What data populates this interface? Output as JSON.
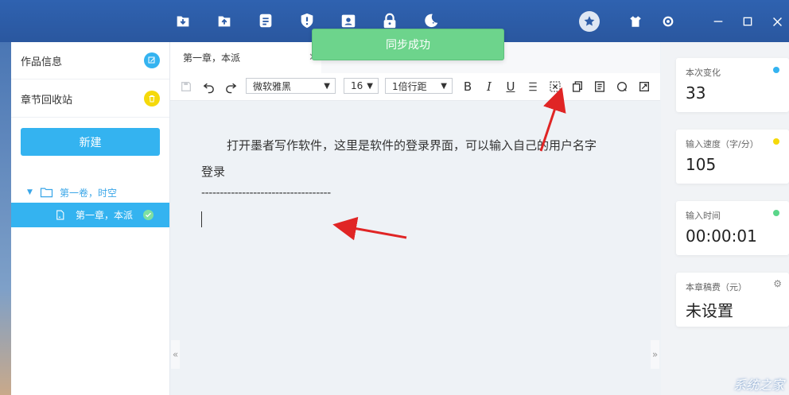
{
  "toolbar_icons": [
    "download-icon",
    "upload-icon",
    "notes-icon",
    "shield-icon",
    "contact-card-icon",
    "lock-icon",
    "night-mode-icon"
  ],
  "window_icons": [
    "favorites-icon",
    "skin-icon",
    "settings-icon",
    "minimize-icon",
    "maximize-icon",
    "close-icon"
  ],
  "toast": {
    "text": "同步成功"
  },
  "sidebar": {
    "work_info": "作品信息",
    "recycle_bin": "章节回收站",
    "new_button": "新建",
    "volume": "第一卷，时空",
    "chapter": "第一章，本派"
  },
  "editor": {
    "tab_title": "第一章，本派",
    "font_family": "微软雅黑",
    "font_size": "16",
    "line_spacing": "1倍行距",
    "bold": "B",
    "italic": "I",
    "underline": "U",
    "paragraph1": "打开墨者写作软件，这里是软件的登录界面，可以输入自己的用户名字",
    "paragraph2": "登录",
    "separator": "-----------------------------------"
  },
  "stats": {
    "change_label": "本次变化",
    "change_value": "33",
    "speed_label": "输入速度（字/分）",
    "speed_value": "105",
    "time_label": "输入时间",
    "time_value": "00:00:01",
    "fee_label": "本章稿费（元）",
    "fee_value": "未设置"
  },
  "colors": {
    "accent": "#34b3f0",
    "topbar": "#2e5da8",
    "toast": "#6dd48c",
    "dot_blue": "#34b3f0",
    "dot_yellow": "#f5d90a",
    "dot_green": "#5bd68a",
    "arrow": "#e02525"
  },
  "watermark": "系统之家"
}
